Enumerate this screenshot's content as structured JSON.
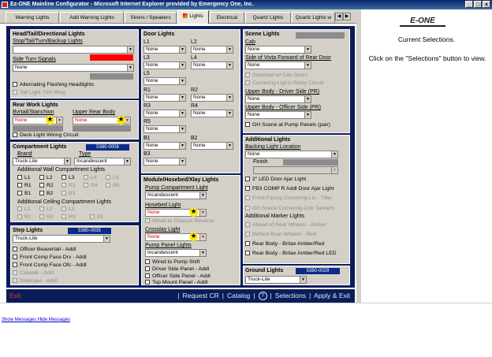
{
  "window": {
    "title": "Ez-ONE Mainline Configurator - Microsoft Internet Explorer provided by Emergency One, Inc.",
    "min": "_",
    "max": "□",
    "close": "×"
  },
  "tabs": [
    {
      "label": "Warning Lights"
    },
    {
      "label": "Add Warning Lights"
    },
    {
      "label": "Sirens / Speakers"
    },
    {
      "label": "Lights"
    },
    {
      "label": "Electrical"
    },
    {
      "label": "Quartz Lights"
    },
    {
      "label": "Quartz Lights w"
    }
  ],
  "tab_arrows": {
    "left": "◀",
    "right": "▶"
  },
  "head": {
    "title": "Head/Tail/Directional Lights",
    "stop_label": "Stop/Tail/Turn/Backup Lights",
    "stop_value": "",
    "side_turn_label": "Side Turn Signals",
    "side_turn_value": "None",
    "alt_flash": "Alternating Flashing Headlights",
    "tail_trim": "Tail Light Trim Ring"
  },
  "rear_work": {
    "title": "Rear Work Lights",
    "col1": "Bvrtail/Stanchion",
    "col2": "Upper Rear Body",
    "val1": "None",
    "val2": "None",
    "deck": "Deck Light Wiring Circuit"
  },
  "compartment": {
    "title": "Compartment Lights",
    "code": "5380-0008",
    "brand_label": "Brand",
    "type_label": "Type",
    "brand": "Truck-Lite",
    "type": "Incandescent",
    "wall_label": "Additional Wall Compartment Lights",
    "ceiling_label": "Additional Ceiling Compartment Lights",
    "wall_row1": [
      "L1",
      "L2",
      "L3",
      "L4",
      "L5"
    ],
    "wall_row2": [
      "R1",
      "R2",
      "R3",
      "R4",
      "R5"
    ],
    "wall_row3": [
      "B1",
      "B2",
      "B3"
    ],
    "ceil_row1": [
      "L1",
      "L2",
      "L3"
    ],
    "ceil_row2": [
      "R1",
      "R2",
      "R3",
      "B1"
    ]
  },
  "step": {
    "title": "Step Lights",
    "code": "5380-0035",
    "value": "Truck-Lite",
    "items": [
      "Officer Beavertail - Addl",
      "Front Comp Face Drv - Addl",
      "Front Comp Face Ofc - Addl",
      "Catwalk - Addl",
      "Staircase - Addl"
    ]
  },
  "door": {
    "title": "Door Lights",
    "none": "None",
    "labels": [
      "L1",
      "L2",
      "L3",
      "L4",
      "L5",
      "R1",
      "R2",
      "R3",
      "R4",
      "R5",
      "B1",
      "B2",
      "B3"
    ]
  },
  "module": {
    "title": "Module/Hosebed/Xlay Lights",
    "pump_comp_label": "Pump Compartment Light",
    "pump_comp": "Incandescent",
    "hosebed_label": "Hosebed Light",
    "hosebed": "None",
    "wired_chassis": "Wired to Chassis Reverse",
    "crosslay_label": "Crosslay Light",
    "crosslay": "None",
    "pump_panel_label": "Pump Panel Lights",
    "pump_panel": "Incandescent",
    "items": [
      "Wired to Pump Shift",
      "Driver Side Panel - Addl",
      "Officer Side Panel - Addl",
      "Top Mount Panel - Addl"
    ]
  },
  "scene": {
    "title": "Scene Lights",
    "cab_label": "Cab",
    "cab": "None",
    "side_vista_label": "Side of Vista Forward of Rear Door",
    "side_vista": "None",
    "switched": "Switched w/ Cab Doors",
    "cornering": "Cornering Lights Relay Circuit",
    "upper_drv_label": "Upper Body - Driver Side (PR)",
    "upper_drv": "None",
    "upper_ofc_label": "Upper Body - Officer Side (PR)",
    "upper_ofc": "None",
    "gh_scene": "GH Scene at Pump Panels (pair)"
  },
  "additional": {
    "title": "Additional Lights",
    "backing_label": "Backing Light Location",
    "backing": "None",
    "finish_label": "Finish",
    "items": [
      "2\" LED Door Ajar Light",
      "FB3 COMP R Addl Door Ajar Light",
      "Front Facing Cornering Lts - Tiller",
      "GH Scene Cornering-Cntr Tandem"
    ],
    "marker_label": "Additional Marker Lights",
    "marker_items": [
      "Ahead of Rear Wheels - Amber",
      "Behind Rear Wheels - Red",
      "Rear Body - Britax Amber/Red",
      "Rear Body - Britax Amber/Red LED"
    ]
  },
  "ground": {
    "title": "Ground Lights",
    "code": "5380-0029",
    "value": "Truck-Lite"
  },
  "bottom": {
    "exit": "Exit",
    "request": "Request CR",
    "catalog": "Catalog",
    "help": "?",
    "selections": "Selections",
    "apply": "Apply & Exit",
    "sep": "|"
  },
  "right": {
    "logo": "E-ONE",
    "current": "Current Selections.",
    "hint": "Click on the \"Selections\" button to view."
  },
  "status": {
    "show": "Show Messages",
    "hide": "Hide Messages"
  },
  "icons": {
    "star": "★",
    "arrow": "▼"
  },
  "colors": {
    "navy": "#0b1d59",
    "panel": "#d4d0c8",
    "red": "#ff0000",
    "code": "#0b2a8a"
  }
}
